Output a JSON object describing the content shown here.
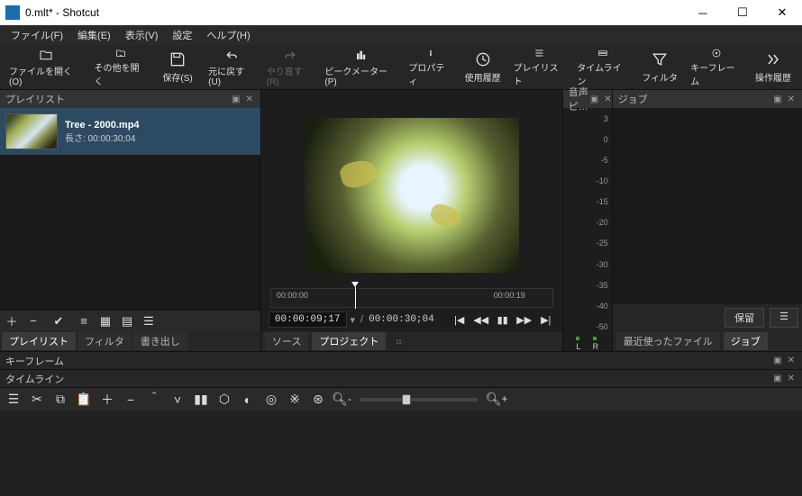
{
  "window": {
    "title": "0.mlt* - Shotcut"
  },
  "menubar": {
    "items": [
      "ファイル(F)",
      "編集(E)",
      "表示(V)",
      "設定",
      "ヘルプ(H)"
    ]
  },
  "toolbar": {
    "open_file": "ファイルを開く(O)",
    "open_other": "その他を開く",
    "save": "保存(S)",
    "undo": "元に戻す(U)",
    "redo": "やり直す(R)",
    "peak_meter": "ピークメーター(P)",
    "properties": "プロパティ",
    "recent": "使用履歴",
    "playlist": "プレイリスト",
    "timeline": "タイムライン",
    "filters": "フィルタ",
    "keyframes": "キーフレーム",
    "history": "操作履歴"
  },
  "playlist": {
    "title": "プレイリスト",
    "item": {
      "name": "Tree - 2000.mp4",
      "duration_label": "長さ: 00:00:30;04"
    }
  },
  "left_tabs": {
    "playlist": "プレイリスト",
    "filter": "フィルタ",
    "export": "書き出し"
  },
  "keyframes_panel": {
    "title": "キーフレーム"
  },
  "timeline_panel": {
    "title": "タイムライン"
  },
  "preview": {
    "scrub": {
      "t0": "00:00:00",
      "t1": "00:00:19"
    },
    "tc_current": "00:00:09;17",
    "tc_total": "00:00:30;04"
  },
  "center_tabs": {
    "source": "ソース",
    "project": "プロジェクト"
  },
  "audio_meter": {
    "title": "音声ピ…",
    "ticks": [
      "3",
      "0",
      "-5",
      "-10",
      "-15",
      "-20",
      "-25",
      "-30",
      "-35",
      "-40",
      "-50"
    ],
    "L": "L",
    "R": "R"
  },
  "jobs": {
    "title": "ジョブ",
    "pending": "保留"
  },
  "jobs_tabs": {
    "recent_files": "最近使ったファイル",
    "jobs": "ジョブ"
  }
}
